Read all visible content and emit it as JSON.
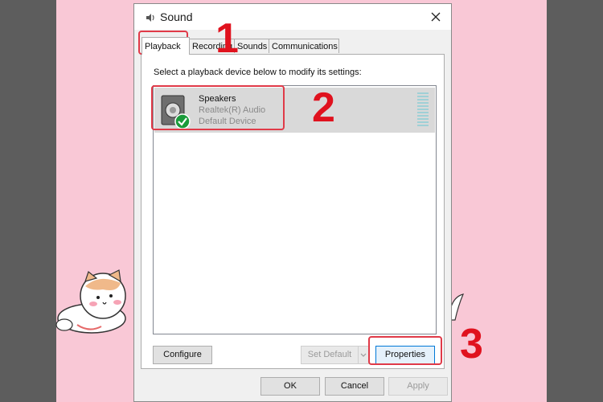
{
  "window": {
    "title": "Sound",
    "icon": "speaker-icon"
  },
  "tabs": [
    {
      "label": "Playback",
      "active": true
    },
    {
      "label": "Recording",
      "active": false
    },
    {
      "label": "Sounds",
      "active": false
    },
    {
      "label": "Communications",
      "active": false
    }
  ],
  "panel": {
    "instruction": "Select a playback device below to modify its settings:",
    "devices": [
      {
        "name": "Speakers",
        "driver": "Realtek(R) Audio",
        "status": "Default Device",
        "icon": "speaker-icon",
        "badge": "green-check-icon"
      }
    ]
  },
  "buttons": {
    "configure": "Configure",
    "set_default": "Set Default",
    "properties": "Properties",
    "ok": "OK",
    "cancel": "Cancel",
    "apply": "Apply"
  },
  "annotations": {
    "step1": "1",
    "step2": "2",
    "step3": "3"
  },
  "colors": {
    "annotation": "#e0121e",
    "highlight": "#e03a48",
    "background": "#f9c8d6",
    "selection": "#d9d9d9"
  }
}
